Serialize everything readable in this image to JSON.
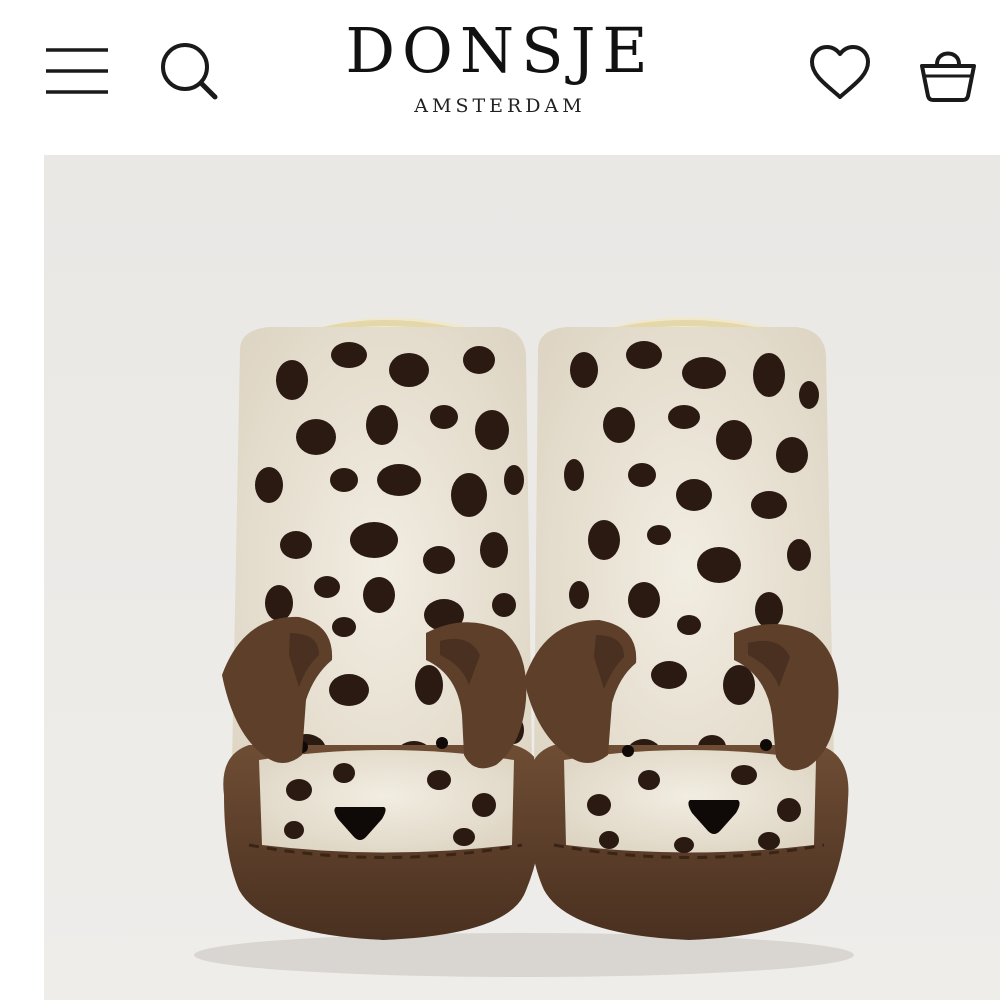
{
  "header": {
    "brand_name": "DONSJE",
    "brand_subtitle": "AMSTERDAM",
    "icons": {
      "menu": "menu-icon",
      "search": "search-icon",
      "wishlist": "heart-icon",
      "cart": "basket-icon"
    }
  },
  "hero": {
    "image": "product-photo-spotted-puppy-baby-booties"
  },
  "colors": {
    "icon": "#1a1a1a",
    "hero_background": "#eceae7",
    "fur": "#ece6d8",
    "spot": "#2a1a12",
    "suede": "#6b4a32"
  }
}
